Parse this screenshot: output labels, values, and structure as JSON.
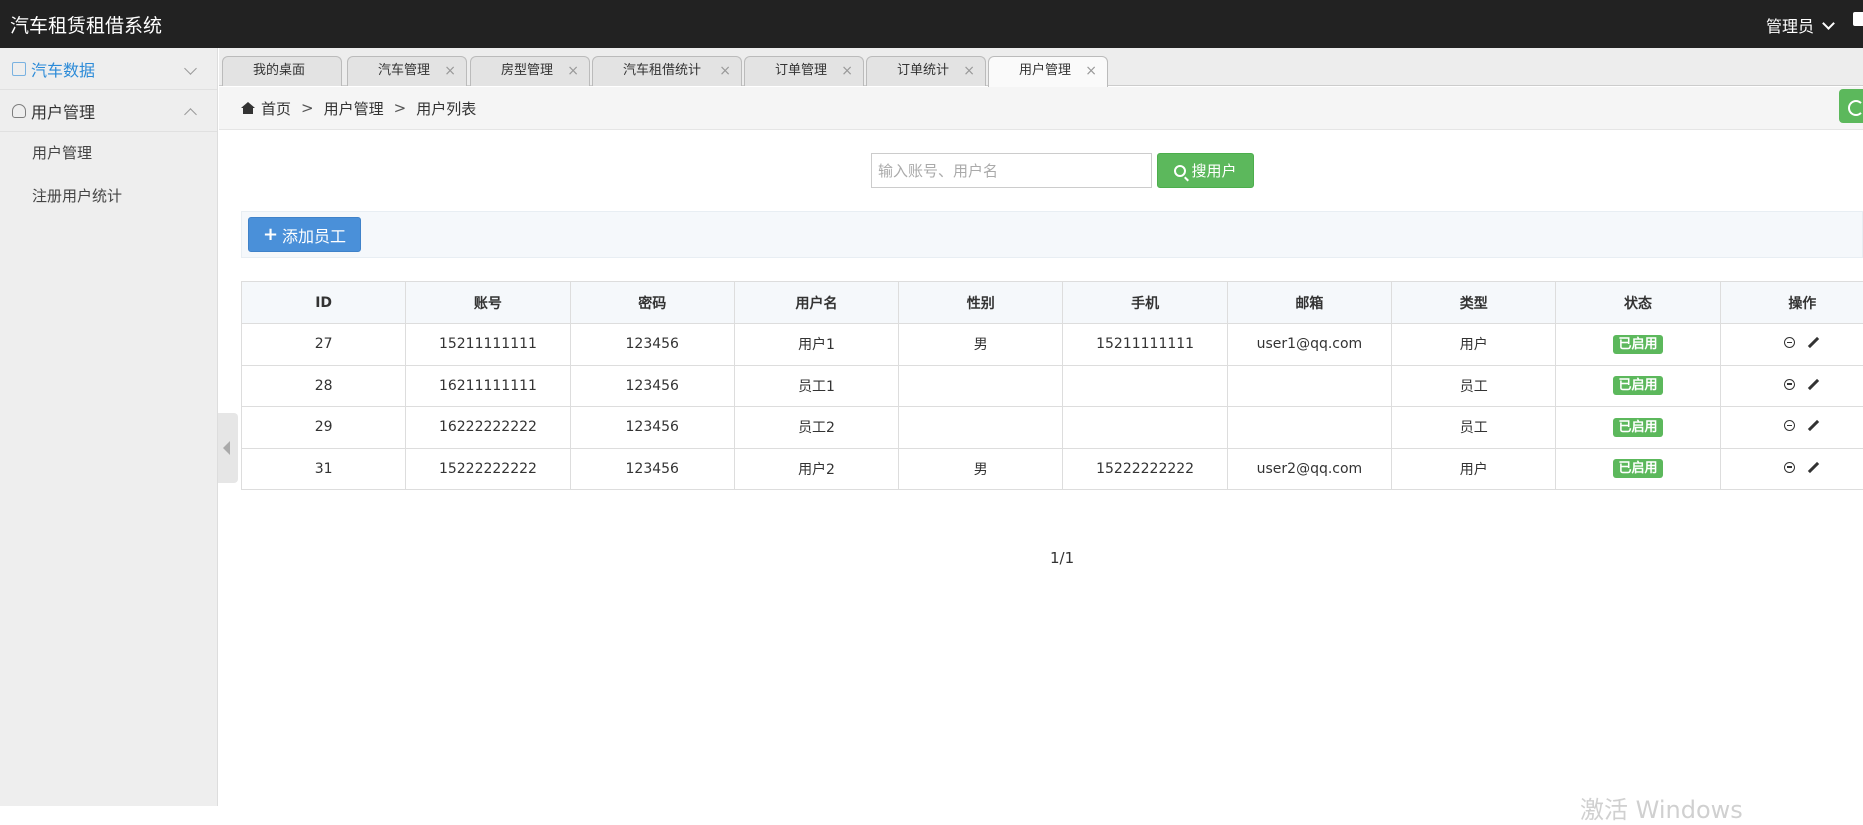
{
  "header": {
    "app_title": "汽车租赁租借系统",
    "admin_label": "管理员"
  },
  "sidebar": {
    "groups": [
      {
        "label": "汽车数据",
        "active": true
      },
      {
        "label": "用户管理",
        "active": false,
        "items": [
          "用户管理",
          "注册用户统计"
        ]
      }
    ]
  },
  "tabs": [
    {
      "label": "我的桌面",
      "closable": false
    },
    {
      "label": "汽车管理",
      "closable": true
    },
    {
      "label": "房型管理",
      "closable": true
    },
    {
      "label": "汽车租借统计",
      "closable": true
    },
    {
      "label": "订单管理",
      "closable": true
    },
    {
      "label": "订单统计",
      "closable": true
    },
    {
      "label": "用户管理",
      "closable": true,
      "active": true
    }
  ],
  "breadcrumb": {
    "home": "首页",
    "sep": ">",
    "level1": "用户管理",
    "level2": "用户列表"
  },
  "search": {
    "placeholder": "输入账号、用户名",
    "value": "",
    "button_label": "搜用户"
  },
  "add_button_label": "添加员工",
  "table": {
    "headers": [
      "ID",
      "账号",
      "密码",
      "用户名",
      "性别",
      "手机",
      "邮箱",
      "类型",
      "状态",
      "操作"
    ],
    "rows": [
      [
        "27",
        "15211111111",
        "123456",
        "用户1",
        "男",
        "15211111111",
        "user1@qq.com",
        "用户",
        "已启用"
      ],
      [
        "28",
        "16211111111",
        "123456",
        "员工1",
        "",
        "",
        "",
        "员工",
        "已启用"
      ],
      [
        "29",
        "16222222222",
        "123456",
        "员工2",
        "",
        "",
        "",
        "员工",
        "已启用"
      ],
      [
        "31",
        "15222222222",
        "123456",
        "用户2",
        "男",
        "15222222222",
        "user2@qq.com",
        "用户",
        "已启用"
      ]
    ]
  },
  "pager": "1/1",
  "watermark": "激活 Windows",
  "colors": {
    "header_bg": "#222222",
    "accent_green": "#5cb85c",
    "accent_blue": "#4a90d9",
    "link_blue": "#2c8bd8"
  }
}
